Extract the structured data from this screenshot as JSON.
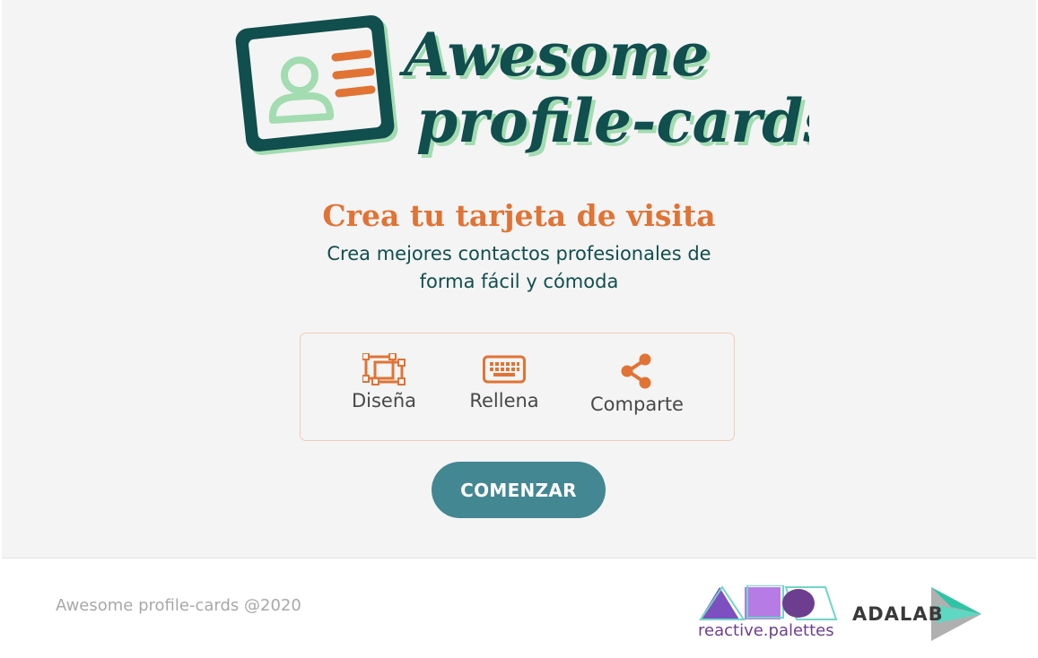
{
  "header": {
    "logo_line1": "Awesome",
    "logo_line2": "profile-cards"
  },
  "hero": {
    "title": "Crea tu tarjeta de visita",
    "subtitle_line1": "Crea mejores contactos profesionales de",
    "subtitle_line2": "forma fácil y cómoda"
  },
  "steps": [
    {
      "label": "Diseña",
      "icon": "design-icon"
    },
    {
      "label": "Rellena",
      "icon": "keyboard-icon"
    },
    {
      "label": "Comparte",
      "icon": "share-icon"
    }
  ],
  "cta": {
    "label": "COMENZAR"
  },
  "footer": {
    "copyright": "Awesome profile-cards @2020",
    "partner1_text": "reactive.palettes",
    "partner2_text": "ADALAB"
  },
  "colors": {
    "accent_orange": "#e17334",
    "dark_teal": "#114e4e",
    "button_teal": "#438792",
    "mint": "#a2dcb0",
    "background": "#f4f4f4"
  }
}
